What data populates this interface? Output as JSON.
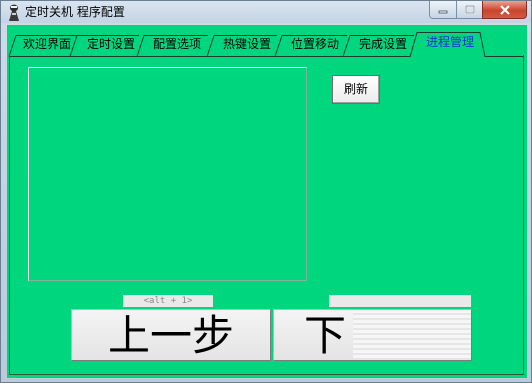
{
  "window": {
    "title": "定时关机 程序配置"
  },
  "icons": {
    "app": "app-icon",
    "minimize": "minimize-icon",
    "maximize": "maximize-icon",
    "close": "close-icon"
  },
  "tabs": [
    {
      "label": "欢迎界面",
      "active": false
    },
    {
      "label": "定时设置",
      "active": false
    },
    {
      "label": "配置选项",
      "active": false
    },
    {
      "label": "热键设置",
      "active": false
    },
    {
      "label": "位置移动",
      "active": false
    },
    {
      "label": "完成设置",
      "active": false
    },
    {
      "label": "进程管理",
      "active": true
    }
  ],
  "process_page": {
    "refresh_label": "刷新"
  },
  "footer": {
    "hotkey_hint": "<alt + 1>",
    "prev_label": "上一步",
    "next_label": "下"
  },
  "colors": {
    "client_background": "#00d67e",
    "active_tab_text": "#1f2fd8",
    "close_button": "#c8452c"
  }
}
